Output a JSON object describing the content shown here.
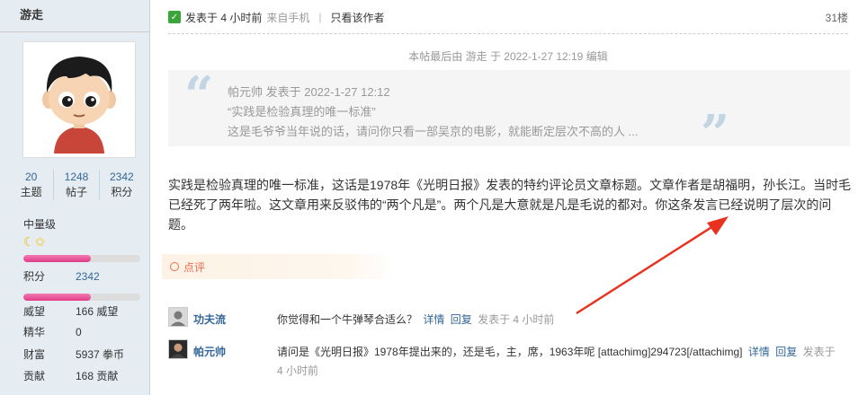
{
  "sidebar": {
    "username": "游走",
    "stats": [
      {
        "value": "20",
        "label": "主题"
      },
      {
        "value": "1248",
        "label": "帖子"
      },
      {
        "value": "2342",
        "label": "积分"
      }
    ],
    "level": "中量级",
    "level_progress_fraction": 0.58,
    "points_progress_fraction": 0.58,
    "rows": [
      {
        "key": "积分",
        "value": "2342"
      },
      {
        "key": "威望",
        "value": "166 威望"
      },
      {
        "key": "精华",
        "value": "0"
      },
      {
        "key": "财富",
        "value": "5937 拳币"
      },
      {
        "key": "贡献",
        "value": "168 贡献"
      }
    ]
  },
  "post": {
    "posted_text": "发表于 4 小时前",
    "from_text": "来自手机",
    "only_author": "只看该作者",
    "floor": "31楼",
    "edit_note": "本帖最后由 游走 于 2022-1-27 12:19 编辑",
    "quote": {
      "author_line": "帕元帅 发表于 2022-1-27 12:12",
      "line1": "“实践是检验真理的唯一标准”",
      "line2": "这是毛爷爷当年说的话，请问你只看一部吴京的电影，就能断定层次不高的人 ..."
    },
    "content": "实践是检验真理的唯一标准，这话是1978年《光明日报》发表的特约评论员文章标题。文章作者是胡福明，孙长江。当时毛已经死了两年啦。这文章用来反驳伟的“两个凡是”。两个凡是大意就是凡是毛说的都对。你这条发言已经说明了层次的问题。"
  },
  "rate": {
    "label": "点评"
  },
  "comments": [
    {
      "name": "功夫流",
      "text": "你觉得和一个牛弹琴合适么？",
      "detail": "详情",
      "reply": "回复",
      "time": "发表于 4 小时前"
    },
    {
      "name": "帕元帅",
      "text": "请问是《光明日报》1978年提出来的，还是毛，主，席，1963年呢 [attachimg]294723[/attachimg]",
      "detail": "详情",
      "reply": "回复",
      "time": "发表于 4 小时前"
    }
  ],
  "colors": {
    "sidebar_bg": "#e5edf2",
    "link": "#336699",
    "progress_pink": "#e23d88",
    "rate_orange": "#f26c4f",
    "annotation_arrow": "#e8321e"
  }
}
